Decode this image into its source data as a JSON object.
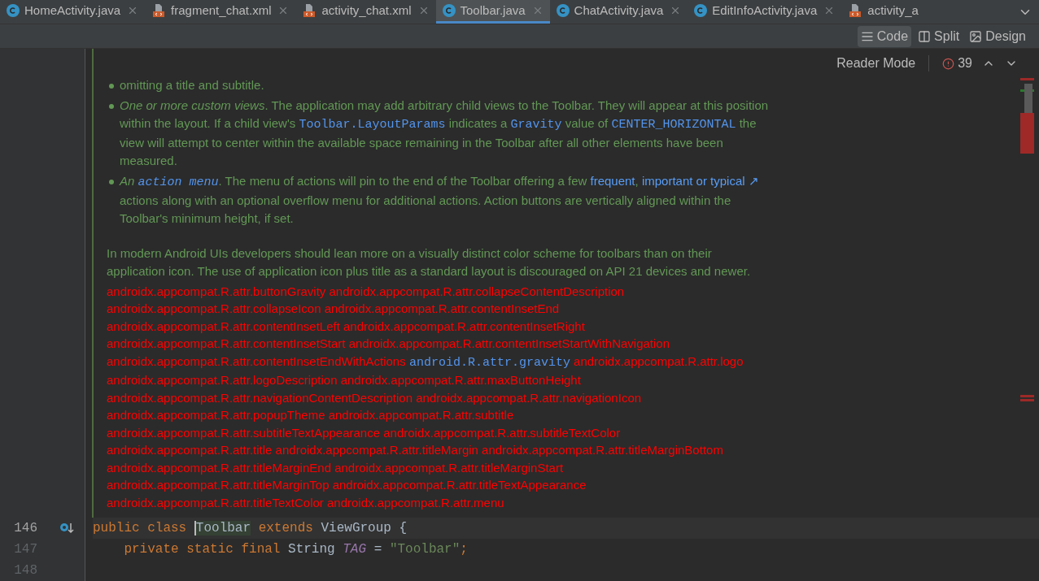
{
  "tabs": [
    {
      "label": "HomeActivity.java",
      "kind": "java",
      "selected": false,
      "closable": true
    },
    {
      "label": "fragment_chat.xml",
      "kind": "xml",
      "selected": false,
      "closable": true
    },
    {
      "label": "activity_chat.xml",
      "kind": "xml",
      "selected": false,
      "closable": true
    },
    {
      "label": "Toolbar.java",
      "kind": "java",
      "selected": true,
      "closable": true
    },
    {
      "label": "ChatActivity.java",
      "kind": "java",
      "selected": false,
      "closable": true
    },
    {
      "label": "EditInfoActivity.java",
      "kind": "java",
      "selected": false,
      "closable": true
    },
    {
      "label": "activity_a",
      "kind": "xml",
      "selected": false,
      "closable": false
    }
  ],
  "view_modes": [
    {
      "label": "Code",
      "kind": "code",
      "selected": true
    },
    {
      "label": "Split",
      "kind": "split",
      "selected": false
    },
    {
      "label": "Design",
      "kind": "design",
      "selected": false
    }
  ],
  "inspection": {
    "reader_mode": "Reader Mode",
    "error_count": "39"
  },
  "doc": {
    "bullets": [
      [
        {
          "kind": "text",
          "text": "omitting a title and subtitle."
        }
      ],
      [
        {
          "kind": "italic",
          "text": "One or more custom views"
        },
        {
          "kind": "text",
          "text": ". The application may add arbitrary child views to the Toolbar. They will appear at this position within the layout. If a child view's "
        },
        {
          "kind": "code",
          "text": "Toolbar.LayoutParams"
        },
        {
          "kind": "text",
          "text": " indicates a "
        },
        {
          "kind": "code",
          "text": "Gravity"
        },
        {
          "kind": "text",
          "text": " value of "
        },
        {
          "kind": "code",
          "text": "CENTER_HORIZONTAL"
        },
        {
          "kind": "text",
          "text": " the view will attempt to center within the available space remaining in the Toolbar after all other elements have been measured."
        }
      ],
      [
        {
          "kind": "italic",
          "text": "An "
        },
        {
          "kind": "italic_code",
          "text": "action menu"
        },
        {
          "kind": "text",
          "text": ". The menu of actions will pin to the end of the Toolbar offering a few "
        },
        {
          "kind": "link",
          "text": "frequent"
        },
        {
          "kind": "text",
          "text": ", "
        },
        {
          "kind": "link",
          "text": "important or typical ↗"
        },
        {
          "kind": "text",
          "text": " actions along with an optional overflow menu for additional actions. Action buttons are vertically aligned within the Toolbar's minimum height, if set."
        }
      ]
    ],
    "paragraph": "In modern Android UIs developers should lean more on a visually distinct color scheme for toolbars than on their application icon. The use of application icon plus title as a standard layout is discouraged on API 21 devices and newer.",
    "references": [
      {
        "kind": "unresolved",
        "text": "androidx.appcompat.R.attr.buttonGravity androidx.appcompat.R.attr.collapseContentDescription androidx.appcompat.R.attr.collapseIcon androidx.appcompat.R.attr.contentInsetEnd androidx.appcompat.R.attr.contentInsetLeft androidx.appcompat.R.attr.contentInsetRight androidx.appcompat.R.attr.contentInsetStart androidx.appcompat.R.attr.contentInsetStartWithNavigation androidx.appcompat.R.attr.contentInsetEndWithActions "
      },
      {
        "kind": "code_link",
        "text": "android.R.attr.gravity"
      },
      {
        "kind": "unresolved",
        "text": " androidx.appcompat.R.attr.logo androidx.appcompat.R.attr.logoDescription androidx.appcompat.R.attr.maxButtonHeight androidx.appcompat.R.attr.navigationContentDescription androidx.appcompat.R.attr.navigationIcon androidx.appcompat.R.attr.popupTheme androidx.appcompat.R.attr.subtitle androidx.appcompat.R.attr.subtitleTextAppearance androidx.appcompat.R.attr.subtitleTextColor androidx.appcompat.R.attr.title androidx.appcompat.R.attr.titleMargin androidx.appcompat.R.attr.titleMarginBottom androidx.appcompat.R.attr.titleMarginEnd androidx.appcompat.R.attr.titleMarginStart androidx.appcompat.R.attr.titleMarginTop androidx.appcompat.R.attr.titleTextAppearance androidx.appcompat.R.attr.titleTextColor androidx.appcompat.R.attr.menu"
      }
    ]
  },
  "code_lines": [
    {
      "number": "146",
      "current": true,
      "override_marker": true,
      "tokens": [
        {
          "kind": "keyword",
          "text": "public class "
        },
        {
          "kind": "highlight",
          "text": "Toolbar"
        },
        {
          "kind": "keyword",
          "text": " extends "
        },
        {
          "kind": "plain",
          "text": "ViewGroup {"
        }
      ]
    },
    {
      "number": "147",
      "current": false,
      "override_marker": false,
      "tokens": [
        {
          "kind": "keyword",
          "text": "    private static final "
        },
        {
          "kind": "plain",
          "text": "String "
        },
        {
          "kind": "field",
          "text": "TAG"
        },
        {
          "kind": "plain",
          "text": " = "
        },
        {
          "kind": "string",
          "text": "\"Toolbar\""
        },
        {
          "kind": "keyword",
          "text": ";"
        }
      ]
    },
    {
      "number": "148",
      "current": false,
      "override_marker": false
    }
  ]
}
